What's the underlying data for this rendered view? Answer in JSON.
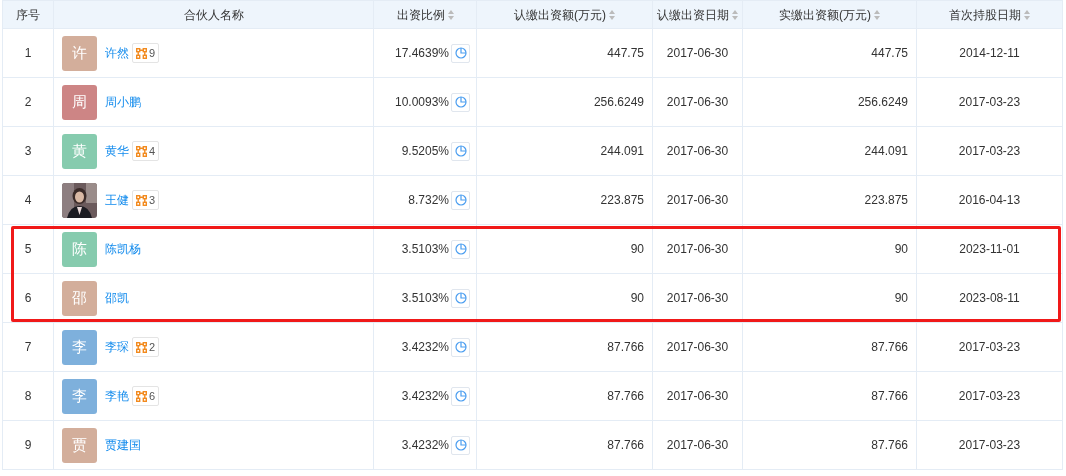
{
  "table": {
    "columns": [
      {
        "label": "序号",
        "sortable": false
      },
      {
        "label": "合伙人名称",
        "sortable": false
      },
      {
        "label": "出资比例",
        "sortable": true
      },
      {
        "label": "认缴出资额(万元)",
        "sortable": true
      },
      {
        "label": "认缴出资日期",
        "sortable": true
      },
      {
        "label": "实缴出资额(万元)",
        "sortable": true
      },
      {
        "label": "首次持股日期",
        "sortable": true
      }
    ],
    "rows": [
      {
        "index": "1",
        "avatar": {
          "kind": "letter",
          "text": "许",
          "color": "#d3ae9b"
        },
        "name": "许然",
        "related_count": "9",
        "ratio": "17.4639%",
        "subscribed": "447.75",
        "subscribed_date": "2017-06-30",
        "paid": "447.75",
        "first_date": "2014-12-11",
        "highlighted": false
      },
      {
        "index": "2",
        "avatar": {
          "kind": "letter",
          "text": "周",
          "color": "#cd8585"
        },
        "name": "周小鹏",
        "ratio": "10.0093%",
        "subscribed": "256.6249",
        "subscribed_date": "2017-06-30",
        "paid": "256.6249",
        "first_date": "2017-03-23",
        "highlighted": false
      },
      {
        "index": "3",
        "avatar": {
          "kind": "letter",
          "text": "黄",
          "color": "#86cbae"
        },
        "name": "黄华",
        "related_count": "4",
        "ratio": "9.5205%",
        "subscribed": "244.091",
        "subscribed_date": "2017-06-30",
        "paid": "244.091",
        "first_date": "2017-03-23",
        "highlighted": false
      },
      {
        "index": "4",
        "name": "王健",
        "related_count": "3",
        "ratio": "8.732%",
        "subscribed": "223.875",
        "subscribed_date": "2017-06-30",
        "paid": "223.875",
        "first_date": "2016-04-13",
        "highlighted": false
      },
      {
        "index": "5",
        "avatar": {
          "kind": "letter",
          "text": "陈",
          "color": "#86cbae"
        },
        "name": "陈凯杨",
        "ratio": "3.5103%",
        "subscribed": "90",
        "subscribed_date": "2017-06-30",
        "paid": "90",
        "first_date": "2023-11-01",
        "highlighted": true
      },
      {
        "index": "6",
        "avatar": {
          "kind": "letter",
          "text": "邵",
          "color": "#d3ae9b"
        },
        "name": "邵凯",
        "ratio": "3.5103%",
        "subscribed": "90",
        "subscribed_date": "2017-06-30",
        "paid": "90",
        "first_date": "2023-08-11",
        "highlighted": true
      },
      {
        "index": "7",
        "avatar": {
          "kind": "letter",
          "text": "李",
          "color": "#7eb0dc"
        },
        "name": "李琛",
        "related_count": "2",
        "ratio": "3.4232%",
        "subscribed": "87.766",
        "subscribed_date": "2017-06-30",
        "paid": "87.766",
        "first_date": "2017-03-23",
        "highlighted": false
      },
      {
        "index": "8",
        "avatar": {
          "kind": "letter",
          "text": "李",
          "color": "#7eb0dc"
        },
        "name": "李艳",
        "related_count": "6",
        "ratio": "3.4232%",
        "subscribed": "87.766",
        "subscribed_date": "2017-06-30",
        "paid": "87.766",
        "first_date": "2017-03-23",
        "highlighted": false
      },
      {
        "index": "9",
        "avatar": {
          "kind": "letter",
          "text": "贾",
          "color": "#d3ae9b"
        },
        "name": "贾建国",
        "ratio": "3.4232%",
        "subscribed": "87.766",
        "subscribed_date": "2017-06-30",
        "paid": "87.766",
        "first_date": "2017-03-23",
        "highlighted": false
      }
    ]
  }
}
